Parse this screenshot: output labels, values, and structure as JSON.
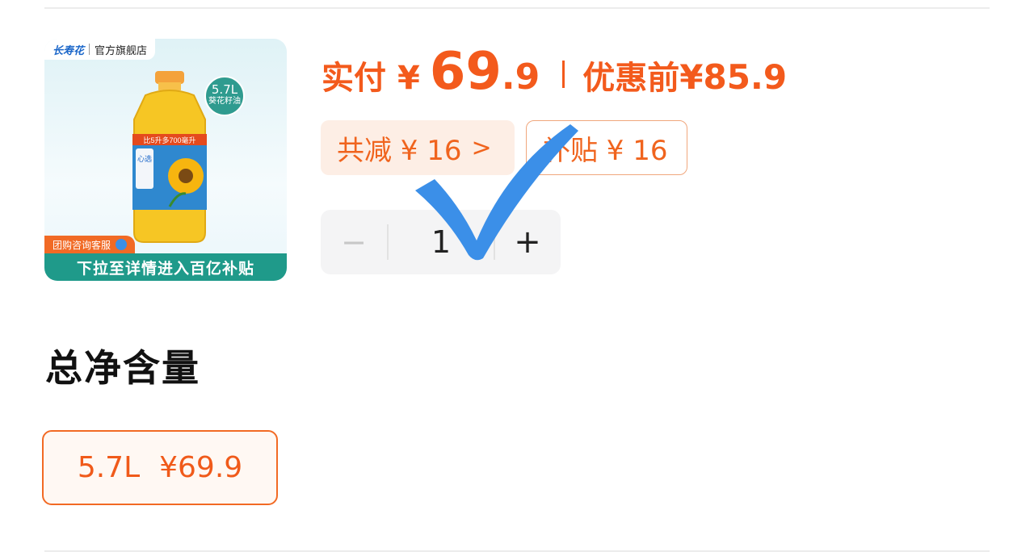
{
  "product": {
    "brand": "长寿花",
    "store": "官方旗舰店",
    "volume_badge": "5.7L",
    "volume_badge_sub": "葵花籽油",
    "label_top": "比5升多700毫升",
    "label_name": "心选",
    "promo_row": "团购咨询客服",
    "banner": "下拉至详情进入百亿补贴"
  },
  "price": {
    "label": "实付",
    "currency": "¥",
    "integer": "69",
    "decimal": ".9",
    "original_label": "优惠前",
    "original_value": "¥85.9",
    "accent_color": "#f35a1c"
  },
  "tags": {
    "total_discount": "共减 ¥ 16",
    "total_chevron": ">",
    "subsidy": "补贴 ¥ 16"
  },
  "quantity": {
    "minus": "−",
    "value": "1",
    "plus": "+"
  },
  "options": {
    "title": "总净含量",
    "selected": {
      "size": "5.7L",
      "price": "¥69.9"
    }
  },
  "overlay": {
    "icon": "check-mark-icon",
    "color": "#3b8fe8"
  }
}
